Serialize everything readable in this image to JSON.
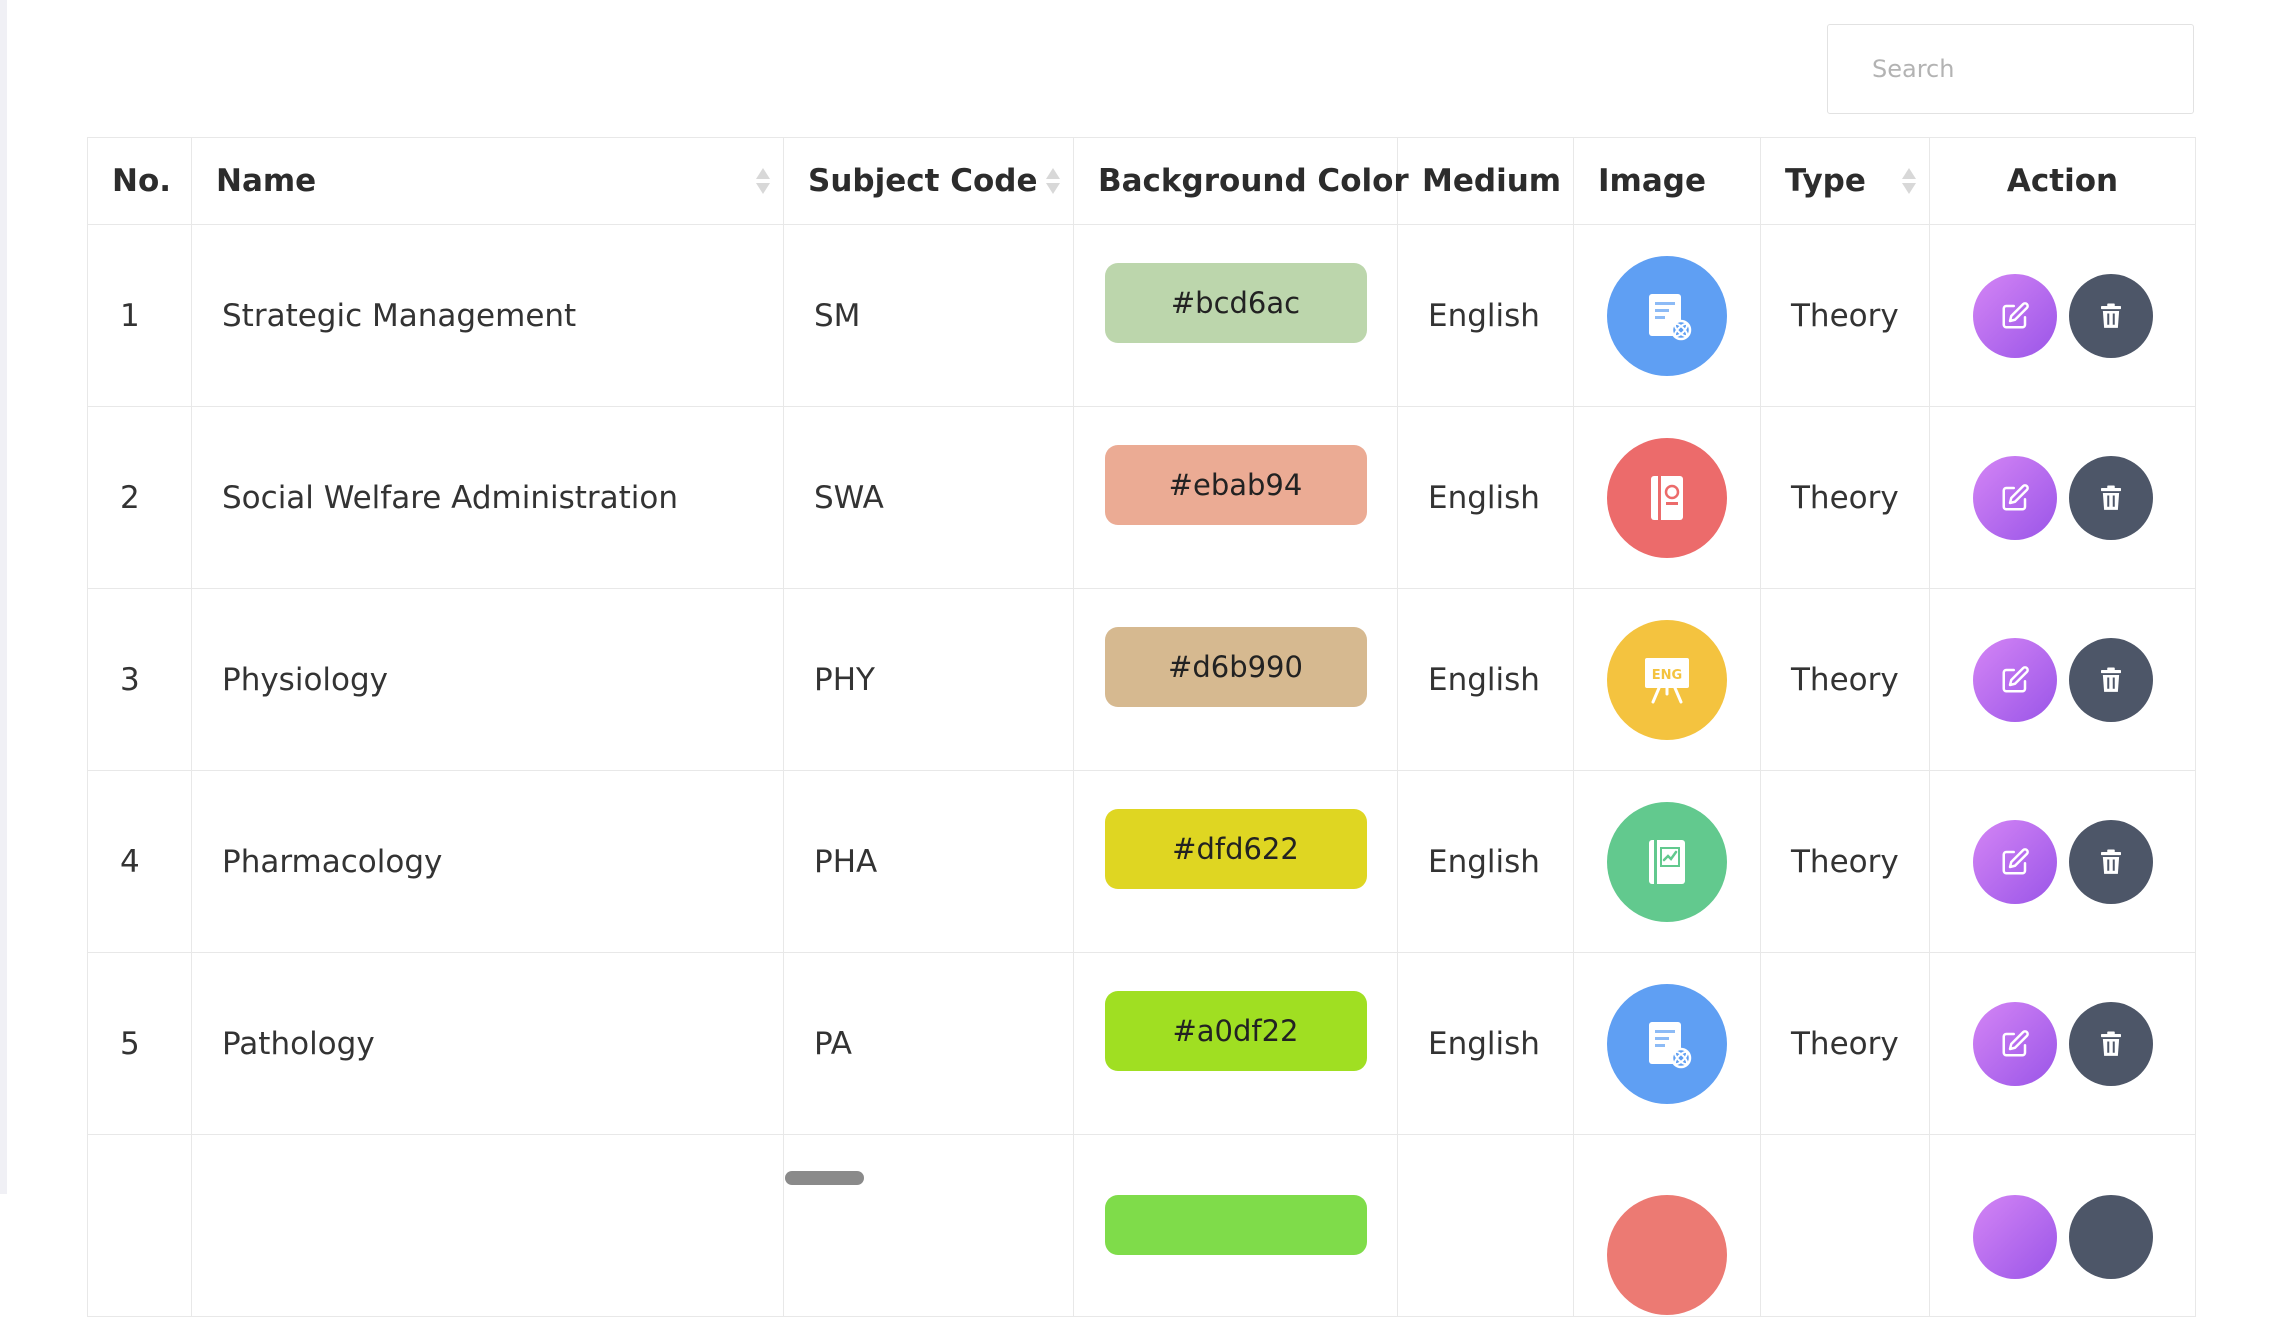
{
  "search": {
    "placeholder": "Search"
  },
  "table": {
    "headers": {
      "no": "No.",
      "name": "Name",
      "code": "Subject Code",
      "color": "Background Color",
      "medium": "Medium",
      "image": "Image",
      "type": "Type",
      "action": "Action"
    },
    "rows": [
      {
        "no": "1",
        "name": "Strategic Management",
        "code": "SM",
        "color": "#bcd6ac",
        "medium": "English",
        "type": "Theory",
        "icon": "science-book-icon",
        "icon_bg": "#5f9ff3"
      },
      {
        "no": "2",
        "name": "Social Welfare Administration",
        "code": "SWA",
        "color": "#ebab94",
        "medium": "English",
        "type": "Theory",
        "icon": "notebook-icon",
        "icon_bg": "#ec6b6b"
      },
      {
        "no": "3",
        "name": "Physiology",
        "code": "PHY",
        "color": "#d6b990",
        "medium": "English",
        "type": "Theory",
        "icon": "english-board-icon",
        "icon_bg": "#f4c33f"
      },
      {
        "no": "4",
        "name": "Pharmacology",
        "code": "PHA",
        "color": "#dfd622",
        "medium": "English",
        "type": "Theory",
        "icon": "chart-book-icon",
        "icon_bg": "#62c98e"
      },
      {
        "no": "5",
        "name": "Pathology",
        "code": "PA",
        "color": "#a0df22",
        "medium": "English",
        "type": "Theory",
        "icon": "science-book-icon",
        "icon_bg": "#5f9ff3"
      }
    ],
    "partial_row": {
      "color": "#7fdc4a",
      "icon_bg": "#ec7a73"
    }
  },
  "colors": {
    "edit_button": "#b56ff0",
    "delete_button": "#4d5668",
    "header_text": "#2c2c2c"
  }
}
